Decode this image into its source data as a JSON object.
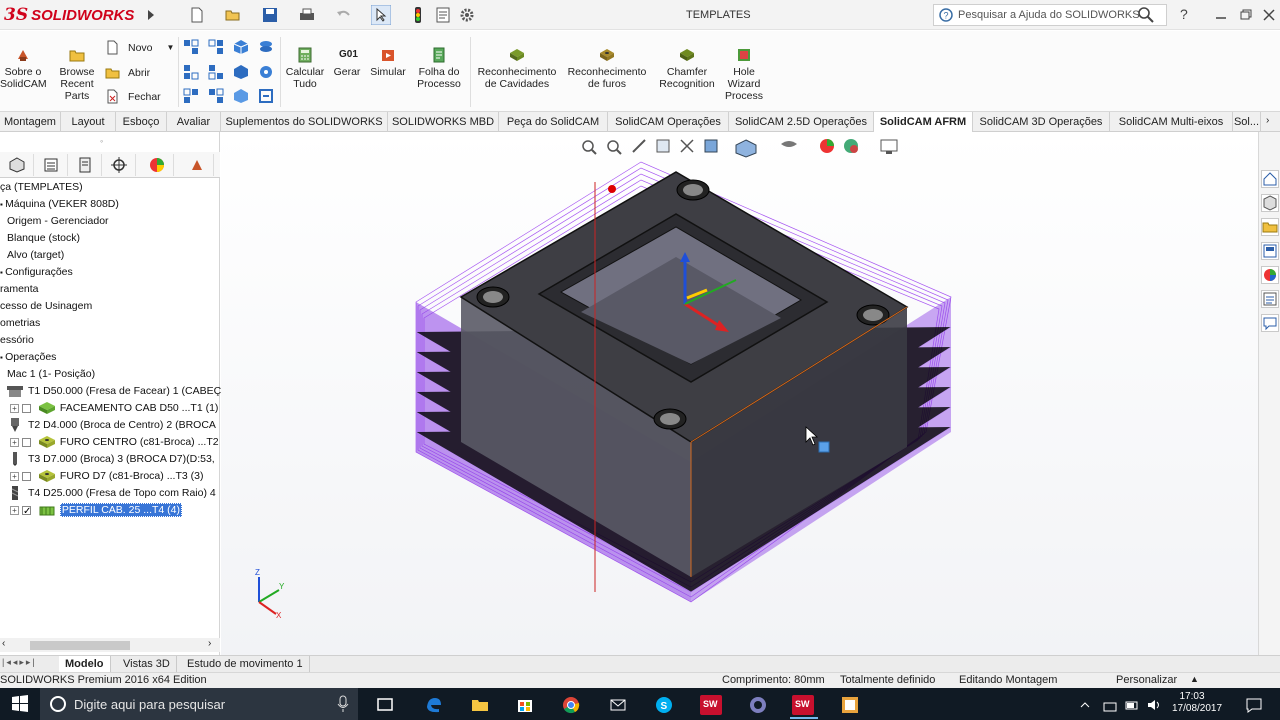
{
  "titlebar": {
    "logo_text": "SOLIDWORKS",
    "logo_prefix": "3S",
    "window_title": "TEMPLATES",
    "help_search_placeholder": "Pesquisar a Ajuda do SOLIDWORKS",
    "help_label": "?"
  },
  "commands": {
    "about": "Sobre o SolidCAM",
    "browse": "Browse Recent Parts",
    "novo": "Novo",
    "abrir": "Abrir",
    "fechar": "Fechar",
    "calcular": "Calcular Tudo",
    "gerar_icon": "G01",
    "gerar": "Gerar",
    "simular": "Simular",
    "folha": "Folha do Processo",
    "cavidades": "Reconhecimento de Cavidades",
    "furos": "Reconhecimento de furos",
    "chamfer": "Chamfer Recognition",
    "hole_wizard": "Hole Wizard Process"
  },
  "tabs": [
    "Montagem",
    "Layout",
    "Esboço",
    "Avaliar",
    "Suplementos do SOLIDWORKS",
    "SOLIDWORKS MBD",
    "Peça do SolidCAM",
    "SolidCAM Operações",
    "SolidCAM 2.5D Operações",
    "SolidCAM AFRM",
    "SolidCAM 3D Operações",
    "SolidCAM Multi-eixos",
    "Sol..."
  ],
  "active_tab": "SolidCAM AFRM",
  "tree": {
    "rows": [
      "ça (TEMPLATES)",
      "Máquina (VEKER 808D)",
      "Origem - Gerenciador",
      "Blanque (stock)",
      "Alvo (target)",
      "Configurações",
      "ramenta",
      "cesso de Usinagem",
      "ometrias",
      "essório",
      "Operações",
      "Mac 1 (1- Posição)",
      "T1  D50.000  (Fresa de Facear) 1 (CABEÇ",
      "FACEAMENTO CAB D50 ...T1 (1)",
      "T2  D4.000  (Broca de Centro) 2 (BROCA",
      "FURO CENTRO (c81-Broca) ...T2",
      "T3  D7.000  (Broca) 3 (BROCA D7)(D:53,",
      "FURO D7 (c81-Broca) ...T3 (3)",
      "T4  D25.000  (Fresa de Topo com Raio) 4",
      "PERFIL CAB. 25 ...T4 (4)"
    ]
  },
  "bottom_tabs": [
    "Modelo",
    "Vistas 3D",
    "Estudo de movimento 1"
  ],
  "status": {
    "edition": "SOLIDWORKS Premium 2016 x64 Edition",
    "length": "Comprimento: 80mm",
    "defined": "Totalmente definido",
    "editing": "Editando Montagem",
    "custom": "Personalizar"
  },
  "taskbar": {
    "search_placeholder": "Digite aqui para pesquisar",
    "time": "17:03",
    "date": "17/08/2017"
  },
  "triad": {
    "x": "X",
    "y": "Y",
    "z": "Z"
  }
}
